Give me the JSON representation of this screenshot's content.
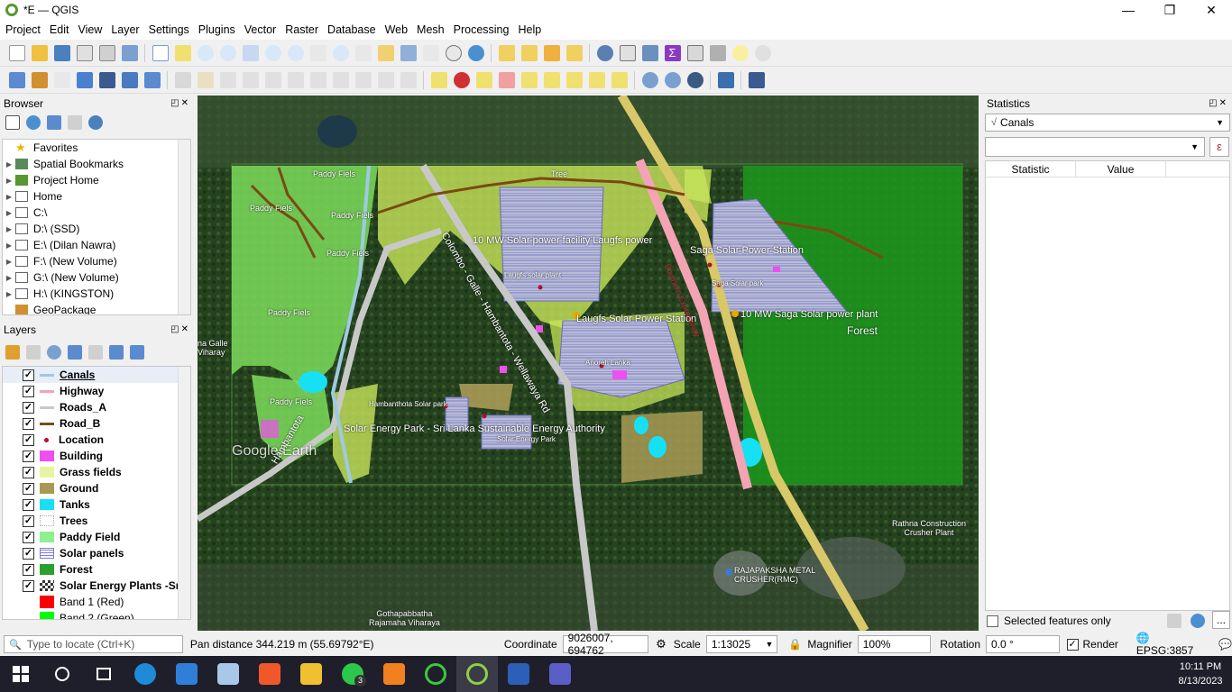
{
  "window": {
    "title": "*E — QGIS",
    "minimize": "—",
    "maximize": "❐",
    "close": "✕"
  },
  "menu": [
    "Project",
    "Edit",
    "View",
    "Layer",
    "Settings",
    "Plugins",
    "Vector",
    "Raster",
    "Database",
    "Web",
    "Mesh",
    "Processing",
    "Help"
  ],
  "browser": {
    "title": "Browser",
    "items": [
      {
        "label": "Favorites",
        "icon": "star-icon"
      },
      {
        "label": "Spatial Bookmarks",
        "icon": "bookmark-icon"
      },
      {
        "label": "Project Home",
        "icon": "project-home-icon"
      },
      {
        "label": "Home",
        "icon": "folder-icon"
      },
      {
        "label": "C:\\",
        "icon": "drive-icon"
      },
      {
        "label": "D:\\ (SSD)",
        "icon": "drive-icon"
      },
      {
        "label": "E:\\ (Dilan Nawra)",
        "icon": "drive-icon"
      },
      {
        "label": "F:\\ (New Volume)",
        "icon": "drive-icon"
      },
      {
        "label": "G:\\ (New Volume)",
        "icon": "drive-icon"
      },
      {
        "label": "H:\\ (KINGSTON)",
        "icon": "drive-icon"
      },
      {
        "label": "GeoPackage",
        "icon": "geopackage-icon"
      }
    ]
  },
  "layers": {
    "title": "Layers",
    "items": [
      {
        "label": "Canals",
        "symbol": "line",
        "color": "#9ecae1"
      },
      {
        "label": "Highway",
        "symbol": "line",
        "color": "#f4a3b4"
      },
      {
        "label": "Roads_A",
        "symbol": "line",
        "color": "#c8c8c8"
      },
      {
        "label": "Road_B",
        "symbol": "line",
        "color": "#7a4a12"
      },
      {
        "label": "Location",
        "symbol": "point",
        "color": "#b0102a"
      },
      {
        "label": "Building",
        "symbol": "fill",
        "color": "#f04ef0"
      },
      {
        "label": "Grass fields",
        "symbol": "fill",
        "color": "#e8f5a0"
      },
      {
        "label": "Ground",
        "symbol": "fill",
        "color": "#a89a55"
      },
      {
        "label": "Tanks",
        "symbol": "fill",
        "color": "#17e0f5"
      },
      {
        "label": "Trees",
        "symbol": "dots",
        "color": "#bde3bd"
      },
      {
        "label": "Paddy Field",
        "symbol": "fill",
        "color": "#8ef08e"
      },
      {
        "label": "Solar panels",
        "symbol": "grid",
        "color": "#7b7bd8"
      },
      {
        "label": "Forest",
        "symbol": "fill",
        "color": "#2ca02c"
      },
      {
        "label": "Solar Energy Plants -Sri",
        "symbol": "raster",
        "color": "#333333"
      },
      {
        "label": "Band 1 (Red)",
        "symbol": "band",
        "color": "#ff0000"
      },
      {
        "label": "Band 2 (Green)",
        "symbol": "band",
        "color": "#00ff00"
      }
    ]
  },
  "statistics": {
    "title": "Statistics",
    "layer": "Canals",
    "col_statistic": "Statistic",
    "col_value": "Value",
    "selected_only": "Selected features only",
    "ellipsis": "...",
    "epsilon": "ε"
  },
  "map_labels": {
    "forest": "Forest",
    "paddy1": "Paddy Fiels",
    "paddy2": "Paddy Fiels",
    "paddy3": "Paddy Fiels",
    "paddy4": "Paddy Fiels",
    "paddy5": "Paddy Fiels",
    "paddy6": "Paddy Fiels",
    "tree": "Tree",
    "laugfs": "Laugfs Solar Power Station",
    "laugfs_plant": "Laugfs solar plant",
    "mw_laugfs": "10 MW Solar power facility Laugfs power",
    "saga_station": "Saga Solar Power Station",
    "saga_park": "Saga Solar park",
    "mw_saga": "10 MW Saga Solar power plant",
    "anoreh": "Anoreh Lanka",
    "hambantota_solar": "Hambanthota Solar park",
    "energy_park": "Solar Energy Park - Sri Lanka Sustainable Energy Authority",
    "solar_energy_park": "Solar Energy Park",
    "rathna": "Rathna Construction\nCrusher Plant",
    "rajapaksha": "RAJAPAKSHA METAL\nCRUSHER(RMC)",
    "gothapabbatha": "Gothapabbatha\nRajamaha Viharaya",
    "google_earth": "Google Earth",
    "galle_viharay": "na Galle\nViharay",
    "colombo_road": "Colombo - Galle - Hambantota - Wellawaya Rd",
    "hambantota_road": "Hambantota",
    "expressway": "Southern Expressway"
  },
  "status": {
    "locate_placeholder": "Type to locate (Ctrl+K)",
    "message": "Pan distance 344.219 m (55.69792°E)",
    "coord_label": "Coordinate",
    "coord_value": "9026007, 694762",
    "scale_label": "Scale",
    "scale_value": "1:13025",
    "magnifier_label": "Magnifier",
    "magnifier_value": "100%",
    "rotation_label": "Rotation",
    "rotation_value": "0.0 °",
    "render_label": "Render",
    "crs": "EPSG:3857"
  },
  "taskbar": {
    "time": "10:11 PM",
    "date": "8/13/2023",
    "whatsapp_badge": "3"
  }
}
